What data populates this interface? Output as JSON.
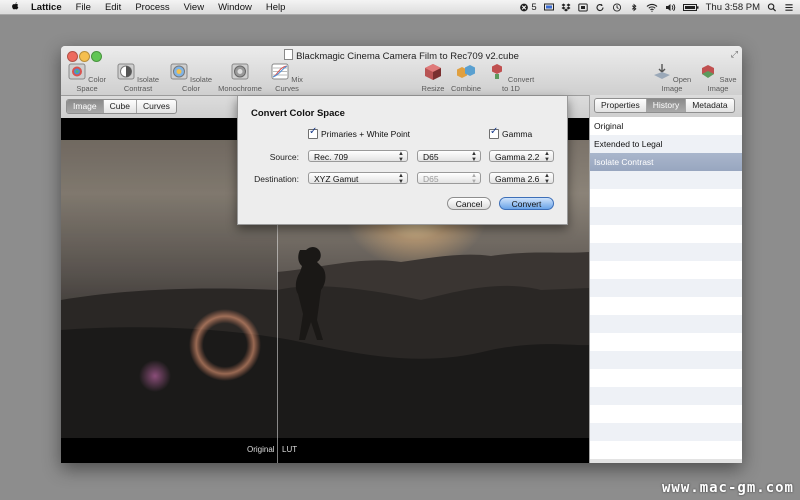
{
  "menubar": {
    "apple_icon": "apple-icon",
    "items": [
      "Lattice",
      "File",
      "Edit",
      "Process",
      "View",
      "Window",
      "Help"
    ],
    "status_count": "5",
    "time": "Thu 3:58 PM"
  },
  "window": {
    "title": "Blackmagic Cinema Camera Film to Rec709 v2.cube",
    "toolbar": [
      {
        "label": "Color Space",
        "icon": "color-space-icon"
      },
      {
        "label": "Isolate Contrast",
        "icon": "isolate-contrast-icon"
      },
      {
        "label": "Isolate Color",
        "icon": "isolate-color-icon"
      },
      {
        "label": "Monochrome",
        "icon": "monochrome-icon"
      },
      {
        "label": "Mix Curves",
        "icon": "mix-curves-icon"
      },
      {
        "label": "Resize",
        "icon": "resize-icon"
      },
      {
        "label": "Combine",
        "icon": "combine-icon"
      },
      {
        "label": "Convert to 1D",
        "icon": "convert-1d-icon"
      },
      {
        "label": "Open Image",
        "icon": "open-image-icon"
      },
      {
        "label": "Save Image",
        "icon": "save-image-icon"
      }
    ]
  },
  "view_tabs": [
    "Image",
    "Cube",
    "Curves"
  ],
  "view_tab_selected": "Image",
  "panel_tabs": [
    "Properties",
    "History",
    "Metadata"
  ],
  "panel_tab_selected": "History",
  "history": [
    {
      "label": "Original",
      "selected": false
    },
    {
      "label": "Extended to Legal",
      "selected": false
    },
    {
      "label": "Isolate Contrast",
      "selected": true
    }
  ],
  "viewer": {
    "left_label": "Original",
    "right_label": "LUT"
  },
  "dialog": {
    "title": "Convert Color Space",
    "primaries_label": "Primaries + White Point",
    "primaries_checked": true,
    "gamma_label": "Gamma",
    "gamma_checked": true,
    "source_label": "Source:",
    "destination_label": "Destination:",
    "source": {
      "primaries": "Rec. 709",
      "white_point": "D65",
      "gamma": "Gamma 2.2"
    },
    "destination": {
      "primaries": "XYZ Gamut",
      "white_point": "D65",
      "gamma": "Gamma 2.6"
    },
    "cancel_label": "Cancel",
    "convert_label": "Convert"
  },
  "watermark": "www.mac-gm.com"
}
